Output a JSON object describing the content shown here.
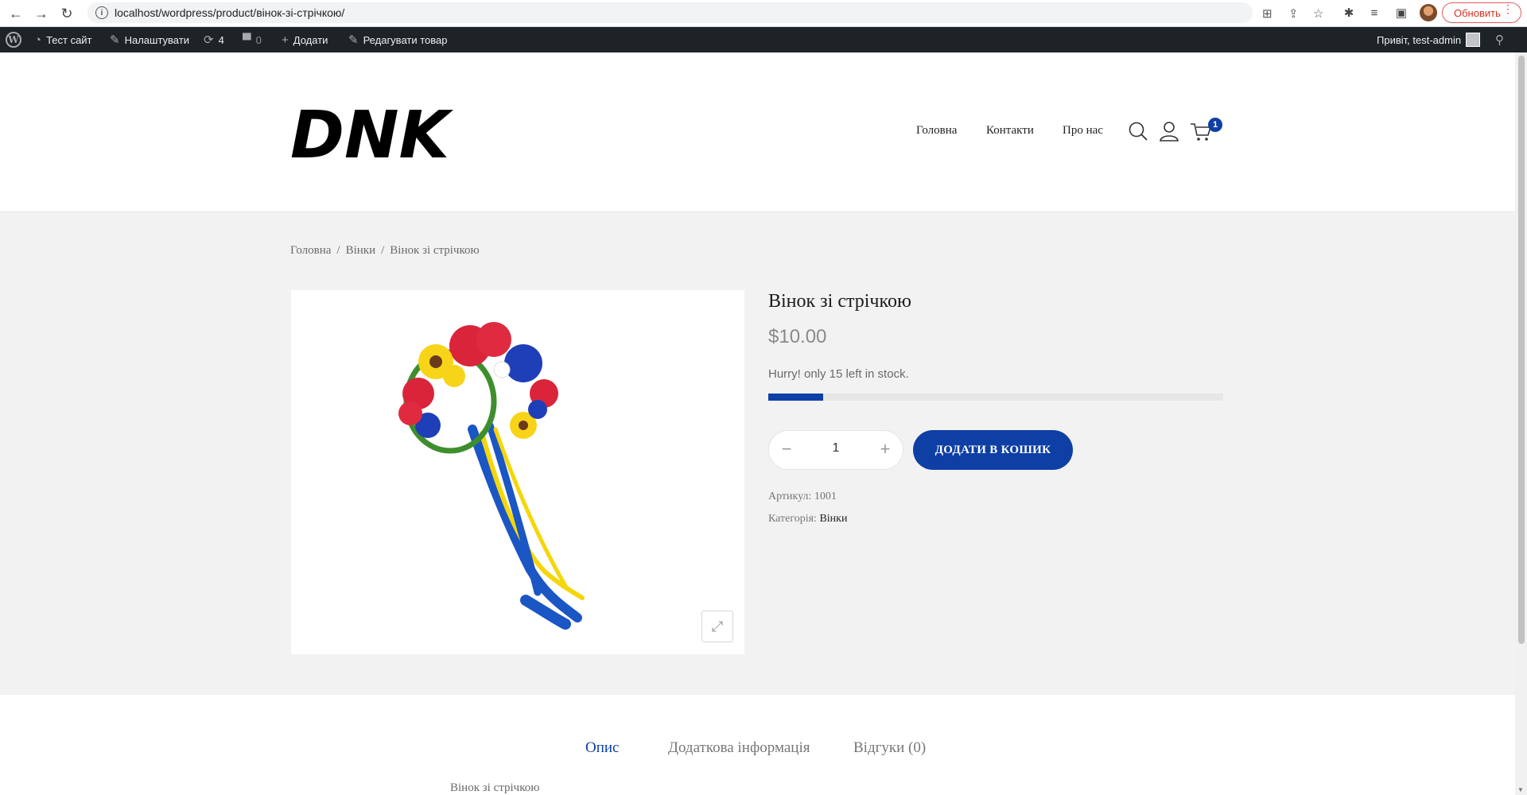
{
  "browser": {
    "url": "localhost/wordpress/product/вінок-зі-стрічкою/",
    "update_label": "Обновить"
  },
  "admin_bar": {
    "site_name": "Тест сайт",
    "customize": "Налаштувати",
    "updates_count": "4",
    "comments_count": "0",
    "new_label": "Додати",
    "edit_label": "Редагувати товар",
    "greeting": "Привіт, test-admin"
  },
  "header": {
    "logo_text": "DNK",
    "nav": [
      "Головна",
      "Контакти",
      "Про нас"
    ],
    "cart_count": "1"
  },
  "breadcrumb": {
    "items": [
      "Головна",
      "Вінки",
      "Вінок зі стрічкою"
    ],
    "separator": "/"
  },
  "product": {
    "title": "Вінок зі стрічкою",
    "price": "$10.00",
    "stock_text": "Hurry! only 15 left in stock.",
    "stock_fraction": 0.12,
    "quantity": "1",
    "minus": "−",
    "plus": "+",
    "add_to_cart": "ДОДАТИ В КОШИК",
    "sku_label": "Артикул:",
    "sku": "1001",
    "category_label": "Категорія:",
    "category": "Вінки"
  },
  "tabs": {
    "items": [
      "Опис",
      "Додаткова інформація",
      "Відгуки (0)"
    ],
    "active": 0,
    "content": "Вінок зі стрічкою"
  },
  "colors": {
    "accent": "#0e3fa5",
    "admin_bar": "#1d2327",
    "page_bg": "#f2f2f2"
  }
}
